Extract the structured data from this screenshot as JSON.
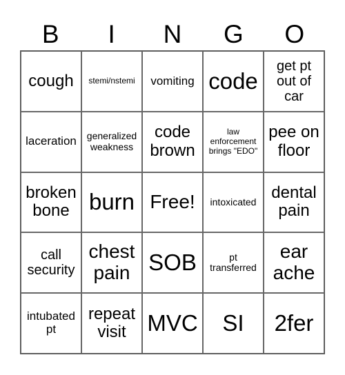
{
  "header": {
    "letters": [
      "B",
      "I",
      "N",
      "G",
      "O"
    ]
  },
  "board": {
    "rows": [
      [
        "cough",
        "stemi/nstemi",
        "vomiting",
        "code",
        "get pt out of car"
      ],
      [
        "laceration",
        "generalized weakness",
        "code brown",
        "law enforcement brings \"EDO\"",
        "pee on floor"
      ],
      [
        "broken bone",
        "burn",
        "Free!",
        "intoxicated",
        "dental pain"
      ],
      [
        "call security",
        "chest pain",
        "SOB",
        "pt transferred",
        "ear ache"
      ],
      [
        "intubated pt",
        "repeat visit",
        "MVC",
        "SI",
        "2fer"
      ]
    ]
  }
}
